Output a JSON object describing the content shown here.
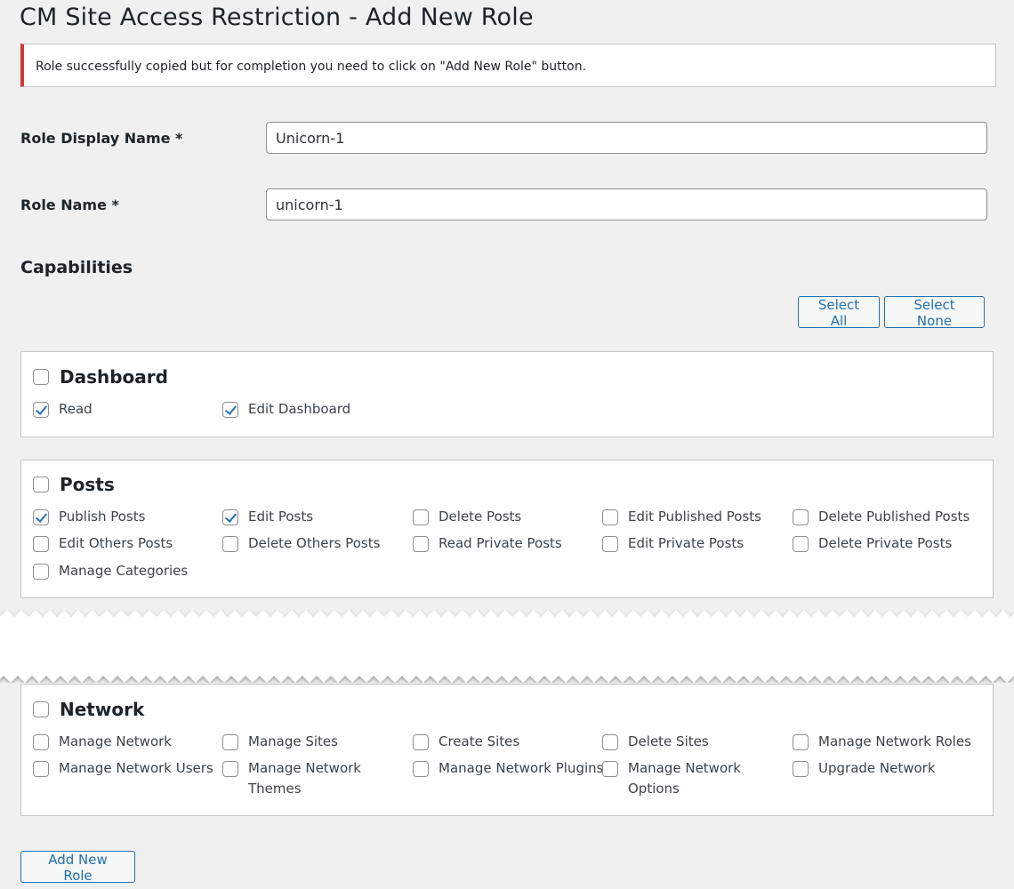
{
  "page_title": "CM Site Access Restriction - Add New Role",
  "notice": "Role successfully copied but for completion you need to click on \"Add New Role\" button.",
  "fields": {
    "display_name_label": "Role Display Name *",
    "display_name_value": "Unicorn-1",
    "role_name_label": "Role Name *",
    "role_name_value": "unicorn-1"
  },
  "capabilities": {
    "title": "Capabilities",
    "select_all": "Select All",
    "select_none": "Select None"
  },
  "groups": {
    "dashboard": {
      "label": "Dashboard",
      "checked": false,
      "items": [
        {
          "label": "Read",
          "checked": true
        },
        {
          "label": "Edit Dashboard",
          "checked": true
        }
      ]
    },
    "posts": {
      "label": "Posts",
      "checked": false,
      "items": [
        {
          "label": "Publish Posts",
          "checked": true
        },
        {
          "label": "Edit Posts",
          "checked": true
        },
        {
          "label": "Delete Posts",
          "checked": false
        },
        {
          "label": "Edit Published Posts",
          "checked": false
        },
        {
          "label": "Delete Published Posts",
          "checked": false
        },
        {
          "label": "Edit Others Posts",
          "checked": false
        },
        {
          "label": "Delete Others Posts",
          "checked": false
        },
        {
          "label": "Read Private Posts",
          "checked": false
        },
        {
          "label": "Edit Private Posts",
          "checked": false
        },
        {
          "label": "Delete Private Posts",
          "checked": false
        },
        {
          "label": "Manage Categories",
          "checked": false
        }
      ]
    },
    "network": {
      "label": "Network",
      "checked": false,
      "items": [
        {
          "label": "Manage Network",
          "checked": false
        },
        {
          "label": "Manage Sites",
          "checked": false
        },
        {
          "label": "Create Sites",
          "checked": false
        },
        {
          "label": "Delete Sites",
          "checked": false
        },
        {
          "label": "Manage Network Roles",
          "checked": false
        },
        {
          "label": "Manage Network Users",
          "checked": false
        },
        {
          "label": "Manage Network Themes",
          "checked": false
        },
        {
          "label": "Manage Network Plugins",
          "checked": false
        },
        {
          "label": "Manage Network Options",
          "checked": false
        },
        {
          "label": "Upgrade Network",
          "checked": false
        }
      ]
    }
  },
  "submit_label": "Add New Role",
  "colors": {
    "accent": "#2271b1",
    "error_border": "#d63638",
    "background": "#f0f0f1"
  }
}
